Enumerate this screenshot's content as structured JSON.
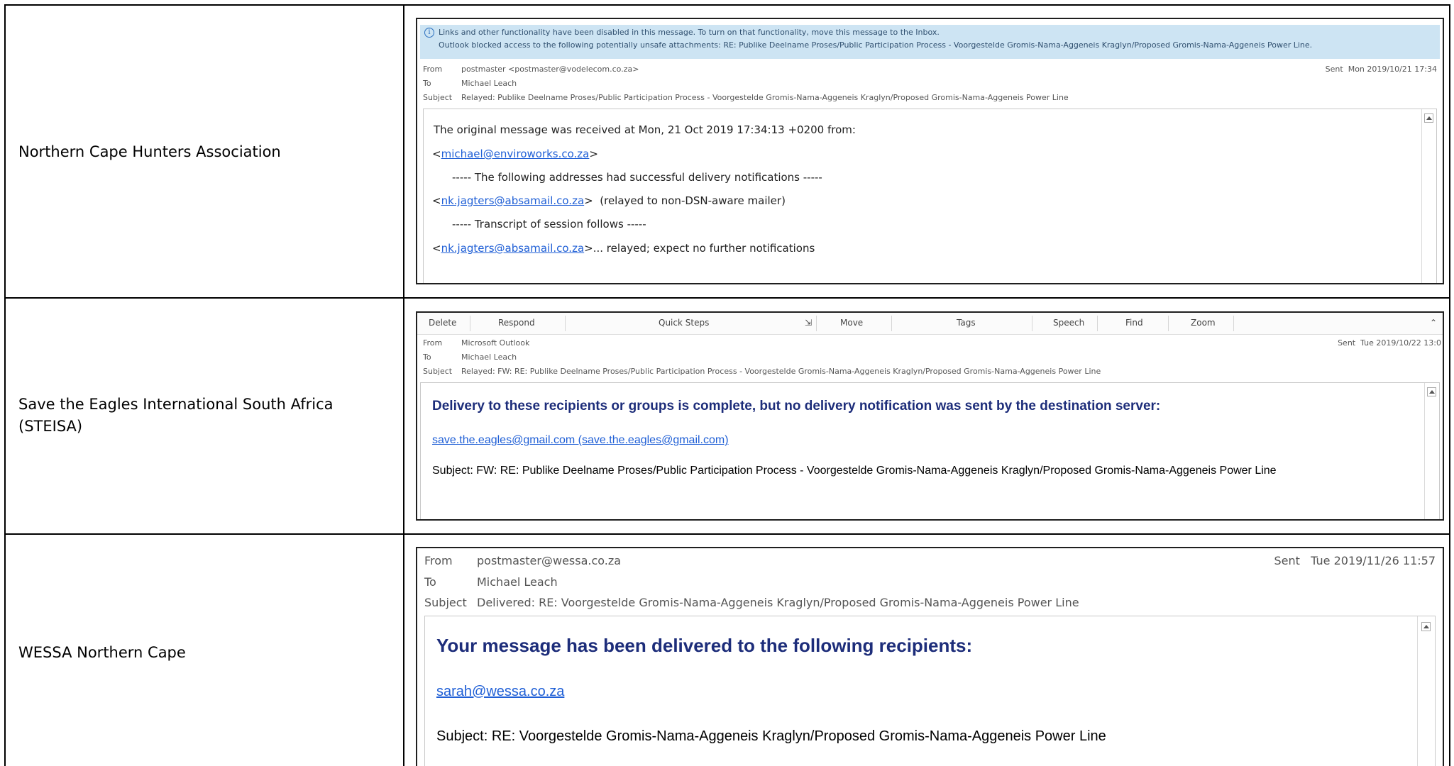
{
  "rows": [
    {
      "organisation": "Northern Cape Hunters Association",
      "email": {
        "info_line1": "Links and other functionality have been disabled in this message. To turn on that functionality, move this message to the Inbox.",
        "info_line2": "Outlook blocked access to the following potentially unsafe attachments: RE: Publike Deelname Proses/Public Participation Process - Voorgestelde Gromis-Nama-Aggeneis Kraglyn/Proposed Gromis-Nama-Aggeneis Power Line.",
        "from_label": "From",
        "from_value": "postmaster <postmaster@vodelecom.co.za>",
        "sent_label": "Sent",
        "sent_value": "Mon 2019/10/21 17:34",
        "to_label": "To",
        "to_value": "Michael Leach",
        "subject_label": "Subject",
        "subject_value": "Relayed: Publike Deelname Proses/Public Participation Process - Voorgestelde Gromis-Nama-Aggeneis Kraglyn/Proposed Gromis-Nama-Aggeneis Power Line",
        "body_line1": "The original message was received at Mon, 21 Oct 2019 17:34:13 +0200 from:",
        "body_line2_link": "michael@enviroworks.co.za",
        "body_line3": "----- The following addresses had successful delivery notifications -----",
        "body_line4_link": "nk.jagters@absamail.co.za",
        "body_line4_rest": "(relayed to non-DSN-aware mailer)",
        "body_line5": "----- Transcript of session follows -----",
        "body_line6_link": "nk.jagters@absamail.co.za",
        "body_line6_rest": "... relayed; expect no further notifications"
      }
    },
    {
      "organisation_line1": "Save the Eagles International South Africa",
      "organisation_line2": "(STEISA)",
      "email": {
        "ribbon": [
          "Delete",
          "Respond",
          "Quick Steps",
          "Move",
          "Tags",
          "Speech",
          "Find",
          "Zoom"
        ],
        "from_label": "From",
        "from_value": "Microsoft Outlook",
        "sent_label": "Sent",
        "sent_value": "Tue 2019/10/22 13:0",
        "to_label": "To",
        "to_value": "Michael Leach",
        "subject_label": "Subject",
        "subject_value": "Relayed: FW: RE: Publike Deelname Proses/Public Participation Process - Voorgestelde Gromis-Nama-Aggeneis Kraglyn/Proposed Gromis-Nama-Aggeneis Power Line",
        "heading": "Delivery to these recipients or groups is complete, but no delivery notification was sent by the destination server:",
        "recipient_link": "save.the.eagles@gmail.com (save.the.eagles@gmail.com)",
        "subject_line": "Subject: FW: RE: Publike Deelname Proses/Public Participation Process - Voorgestelde Gromis-Nama-Aggeneis Kraglyn/Proposed Gromis-Nama-Aggeneis Power Line"
      }
    },
    {
      "organisation": "WESSA Northern Cape",
      "email": {
        "from_label": "From",
        "from_value": "postmaster@wessa.co.za",
        "sent_label": "Sent",
        "sent_value": "Tue 2019/11/26 11:57",
        "to_label": "To",
        "to_value": "Michael Leach",
        "subject_label": "Subject",
        "subject_value": "Delivered: RE: Voorgestelde Gromis-Nama-Aggeneis Kraglyn/Proposed Gromis-Nama-Aggeneis Power Line",
        "heading": "Your message has been delivered to the following recipients:",
        "recipient_link": "sarah@wessa.co.za",
        "subject_line": "Subject: RE: Voorgestelde Gromis-Nama-Aggeneis Kraglyn/Proposed Gromis-Nama-Aggeneis Power Line"
      }
    }
  ]
}
